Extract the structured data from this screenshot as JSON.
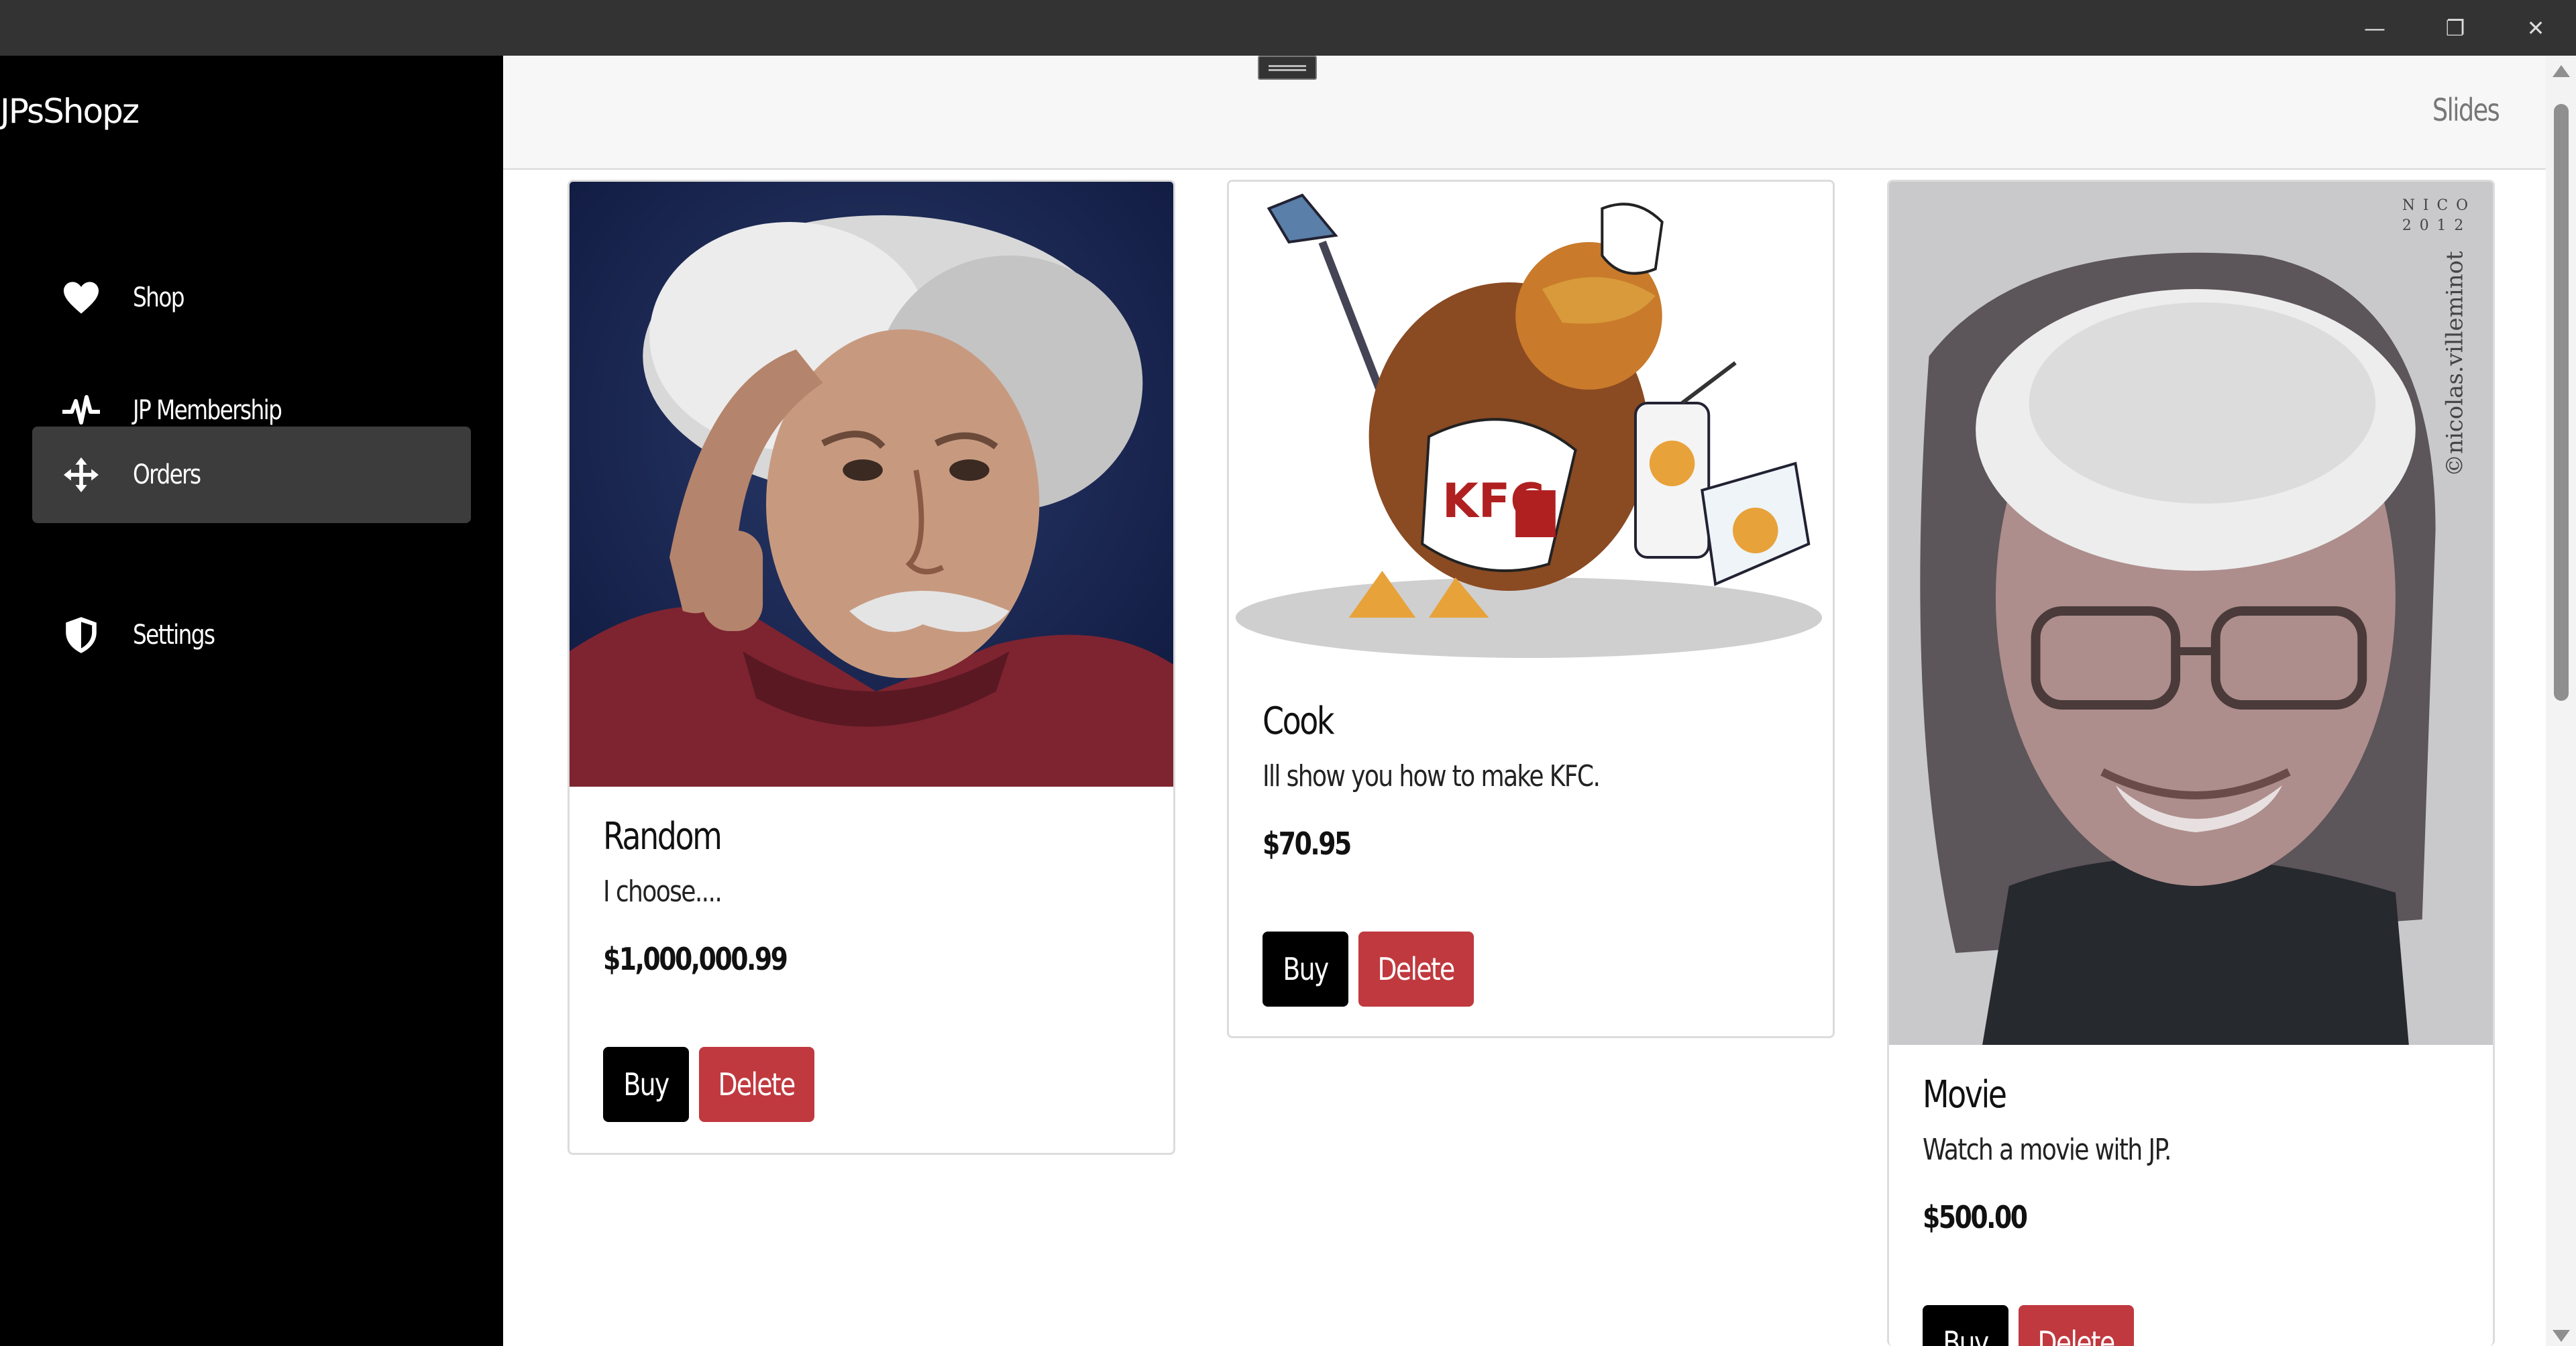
{
  "window": {
    "minimize": "—",
    "restore": "❐",
    "close": "✕"
  },
  "sidebar": {
    "brand": "JPsShopz",
    "items": [
      {
        "label": "Shop",
        "icon": "heart-icon"
      },
      {
        "label": "JP Membership",
        "icon": "pulse-icon"
      },
      {
        "label": "Orders",
        "icon": "move-arrows-icon",
        "active": true
      },
      {
        "label": "Settings",
        "icon": "shield-icon"
      }
    ]
  },
  "topbar": {
    "slides_label": "Slides"
  },
  "products": [
    {
      "title": "Random",
      "description": "I choose....",
      "price": "$1,000,000.99",
      "buy_label": "Buy",
      "delete_label": "Delete"
    },
    {
      "title": "Cook",
      "description": "Ill show you how to make KFC.",
      "price": "$70.95",
      "buy_label": "Buy",
      "delete_label": "Delete"
    },
    {
      "title": "Movie",
      "description": "Watch a movie with JP.",
      "price": "$500.00",
      "buy_label": "Buy",
      "delete_label": "Delete"
    }
  ],
  "image_text": {
    "signature": "©nicolas.villeminot",
    "stamp_line1": "NICO",
    "stamp_line2": "2012",
    "apron": "KFC"
  },
  "colors": {
    "sidebar_bg": "#000000",
    "buy_btn": "#000000",
    "delete_btn": "#c0393f",
    "active_item": "#3c3c3c"
  }
}
